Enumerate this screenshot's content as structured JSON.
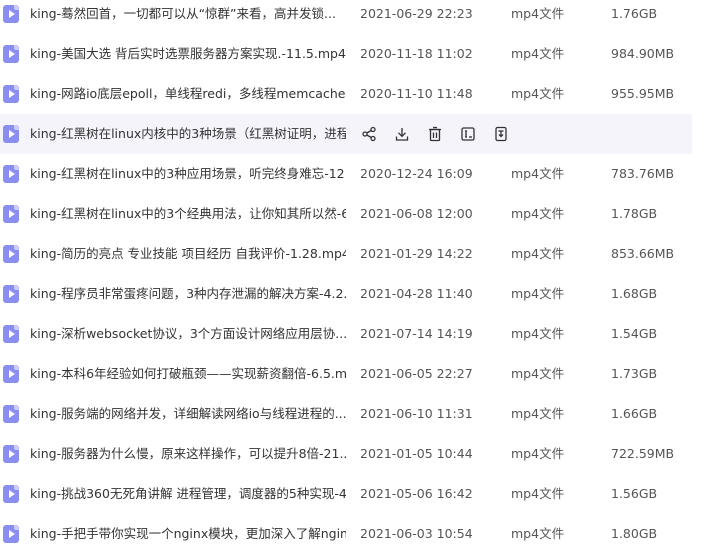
{
  "files": [
    {
      "name": "king-蓦然回首，一切都可以从“惊群”来看，高并发锁...",
      "date": "2021-06-29 22:23",
      "type": "mp4文件",
      "size": "1.76GB"
    },
    {
      "name": "king-美国大选 背后实时选票服务器方案实现.-11.5.mp4",
      "date": "2020-11-18 11:02",
      "type": "mp4文件",
      "size": "984.90MB"
    },
    {
      "name": "king-网路io底层epoll，单线程redi，多线程memcache...",
      "date": "2020-11-10 11:48",
      "type": "mp4文件",
      "size": "955.95MB"
    },
    {
      "name": "king-红黑树在linux内核中的3种场景（红黑树证明，进程...",
      "date": "",
      "type": "",
      "size": "",
      "hover": true
    },
    {
      "name": "king-红黑树在linux中的3种应用场景，听完终身难忘-12....",
      "date": "2020-12-24 16:09",
      "type": "mp4文件",
      "size": "783.76MB"
    },
    {
      "name": "king-红黑树在linux中的3个经典用法，让你知其所以然-6...",
      "date": "2021-06-08 12:00",
      "type": "mp4文件",
      "size": "1.78GB"
    },
    {
      "name": "king-简历的亮点 专业技能 项目经历 自我评价-1.28.mp4",
      "date": "2021-01-29 14:22",
      "type": "mp4文件",
      "size": "853.66MB"
    },
    {
      "name": "king-程序员非常蛋疼问题，3种内存泄漏的解决方案-4.2...",
      "date": "2021-04-28 11:40",
      "type": "mp4文件",
      "size": "1.68GB"
    },
    {
      "name": "king-深析websocket协议，3个方面设计网络应用层协...",
      "date": "2021-07-14 14:19",
      "type": "mp4文件",
      "size": "1.54GB"
    },
    {
      "name": "king-本科6年经验如何打破瓶颈——实现薪资翻倍-6.5.m...",
      "date": "2021-06-05 22:27",
      "type": "mp4文件",
      "size": "1.73GB"
    },
    {
      "name": "king-服务端的网络并发，详细解读网络io与线程进程的...",
      "date": "2021-06-10 11:31",
      "type": "mp4文件",
      "size": "1.66GB"
    },
    {
      "name": "king-服务器为什么慢，原来这样操作，可以提升8倍-21....",
      "date": "2021-01-05 10:44",
      "type": "mp4文件",
      "size": "722.59MB"
    },
    {
      "name": "king-挑战360无死角讲解 进程管理，调度器的5种实现-4...",
      "date": "2021-05-06 16:42",
      "type": "mp4文件",
      "size": "1.56GB"
    },
    {
      "name": "king-手把手带你实现一个nginx模块，更加深入了解ngin...",
      "date": "2021-06-03 10:54",
      "type": "mp4文件",
      "size": "1.80GB"
    }
  ],
  "hover_actions": [
    {
      "icon": "share-icon"
    },
    {
      "icon": "download-icon"
    },
    {
      "icon": "delete-icon"
    },
    {
      "icon": "rename-icon"
    },
    {
      "icon": "more-icon"
    }
  ],
  "colors": {
    "file_icon": "#8a8ef0",
    "hover_row": "#f4f4fa",
    "text": "#333333"
  }
}
